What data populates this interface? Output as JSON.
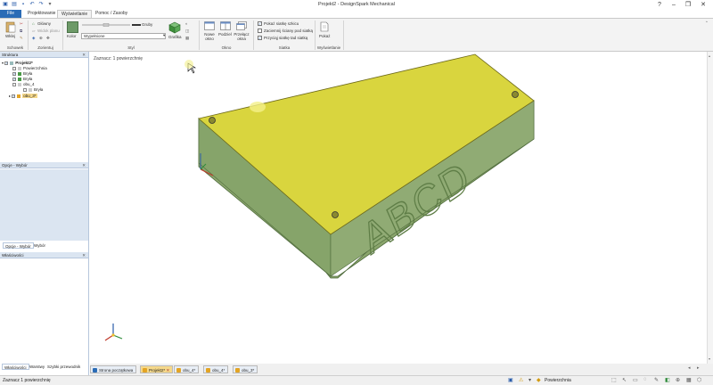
{
  "window": {
    "title": "Projekt2 - DesignSpark Mechanical"
  },
  "tabs": [
    "File",
    "Projektowanie",
    "Wyświetlanie",
    "Pomoc / Zasoby"
  ],
  "ribbon": {
    "clipboard": {
      "paste_label": "Wklej",
      "group": "Schowek"
    },
    "orient": {
      "home_label": "Główny",
      "view_plane_label": "Widok planu",
      "group": "Zorientuj"
    },
    "style": {
      "weight_label": "Gruby",
      "color_label": "Kolor",
      "linestyle_value": "Wypełnione",
      "graphics_label": "Grafika",
      "group": "Styl"
    },
    "window": {
      "new_label": "Nowe okno",
      "split_label": "Podziel",
      "switch_label": "Przełącz okna",
      "group": "Okno"
    },
    "grid": {
      "opt1": "Pokaż siatkę szkicu",
      "opt2": "Zaciemnij ściany pod siatką",
      "opt3": "Przyciąj siatkę tad siatką",
      "group": "Siatka"
    },
    "show": {
      "label": "Pokaż",
      "group": "Wyświetlanie"
    }
  },
  "structure": {
    "title": "Struktura",
    "items": [
      "Projekt2*",
      "Powierzchnia",
      "Bryła",
      "Bryła",
      "obu_4",
      "Bryła",
      "obu_3*"
    ]
  },
  "options_panel": {
    "title": "Opcje - Wybór",
    "tabs": [
      "Opcje - Wybór",
      "Wybór"
    ]
  },
  "properties_panel": {
    "title": "Właściwości"
  },
  "bottom_left_tabs": [
    "Właściwości",
    "Warstwy",
    "Szybki przewodnik"
  ],
  "viewport": {
    "status": "Zaznacz: 1 powierzchnię",
    "model_text": "ABCD"
  },
  "doc_tabs": [
    "Strona początkowa",
    "Projekt2*",
    "obu_4*",
    "obu_4*",
    "obu_3*"
  ],
  "statusbar": {
    "left": "Zaznacz 1 powierzchnię",
    "selection_filter": "Powierzchnia"
  },
  "colors": {
    "file_tab": "#2b6cb6",
    "panel_header": "#dbe5f1",
    "model_top": "#d9d53e",
    "model_side": "#8da86f",
    "active_doc_tab": "#f5d88a"
  }
}
